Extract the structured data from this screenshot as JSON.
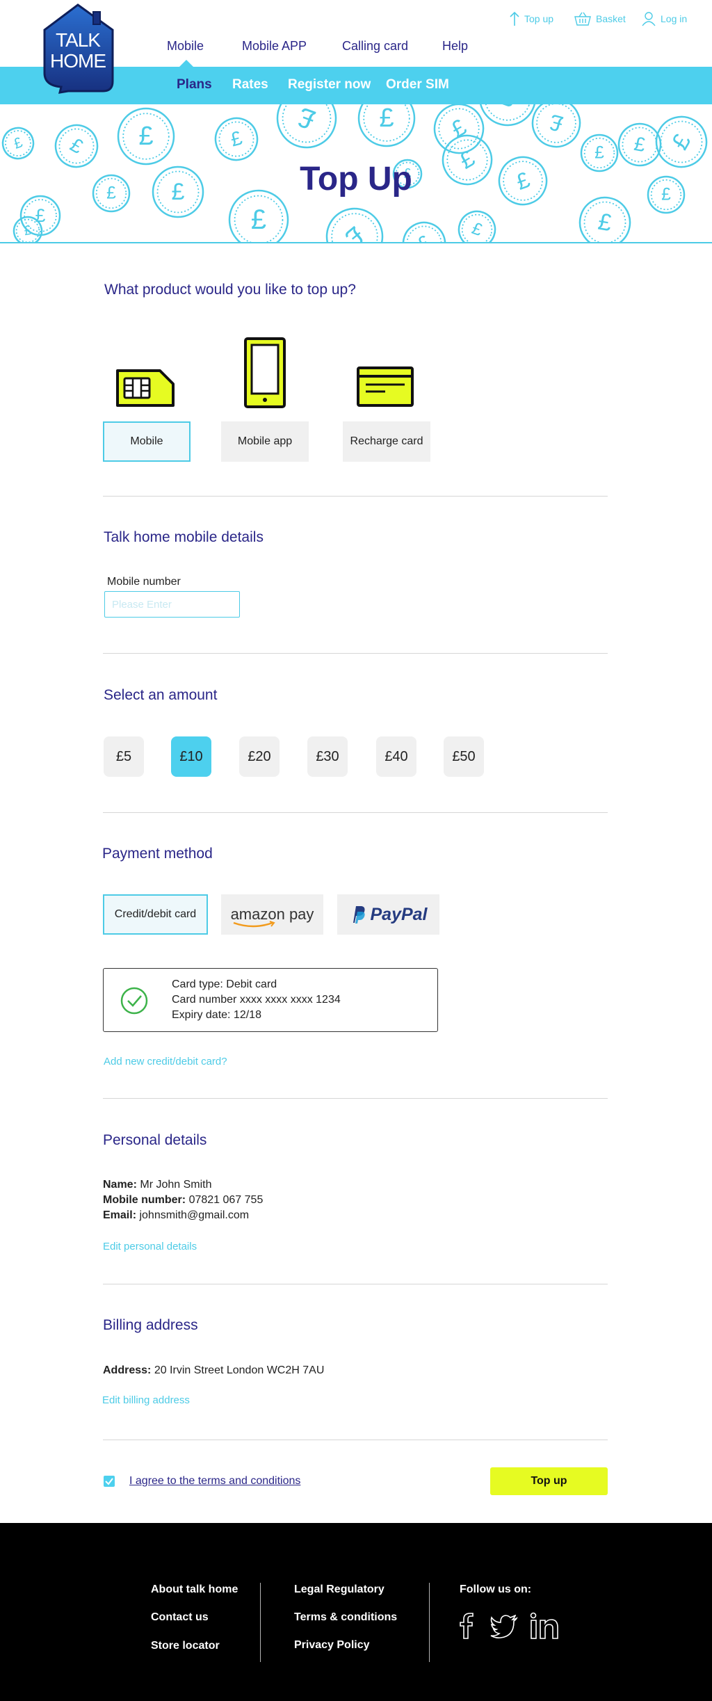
{
  "header": {
    "logo_text_line1": "TALK",
    "logo_text_line2": "HOME",
    "util_links": [
      {
        "label": "Top up",
        "icon": "arrow-up-icon"
      },
      {
        "label": "Basket",
        "icon": "basket-icon"
      },
      {
        "label": "Log in",
        "icon": "user-icon"
      }
    ],
    "main_nav": [
      "Mobile",
      "Mobile APP",
      "Calling card",
      "Help"
    ],
    "sub_nav": [
      "Plans",
      "Rates",
      "Register now",
      "Order SIM"
    ]
  },
  "hero": {
    "title": "Top Up",
    "coin_symbol": "£"
  },
  "product": {
    "title": "What product would you like to top up?",
    "options": [
      "Mobile",
      "Mobile app",
      "Recharge card"
    ],
    "selected": "Mobile"
  },
  "mobile_details": {
    "title": "Talk home mobile details",
    "label": "Mobile number",
    "placeholder": "Please Enter"
  },
  "amount": {
    "title": "Select an amount",
    "options": [
      "£5",
      "£10",
      "£20",
      "£30",
      "£40",
      "£50"
    ],
    "selected": "£10"
  },
  "payment": {
    "title": "Payment method",
    "options": [
      "Credit/debit card",
      "amazon pay",
      "PayPal"
    ],
    "selected": "Credit/debit card",
    "card_type": "Card type: Debit card",
    "card_number": "Card number xxxx xxxx xxxx 1234",
    "expiry": "Expiry date: 12/18",
    "add_card_link": "Add new credit/debit card?"
  },
  "personal": {
    "title": "Personal details",
    "name_label": "Name:",
    "name_value": "Mr John Smith",
    "mobile_label": "Mobile number:",
    "mobile_value": "07821 067 755",
    "email_label": "Email:",
    "email_value": "johnsmith@gmail.com",
    "edit_link": "Edit personal details"
  },
  "billing": {
    "title": "Billing address",
    "address_label": "Address:",
    "address_value": "20 Irvin Street London WC2H 7AU",
    "edit_link": "Edit billing address"
  },
  "submit": {
    "terms_label": "I agree to the terms and conditions",
    "terms_checked": true,
    "button_label": "Top up"
  },
  "footer": {
    "col1": [
      "About talk home",
      "Contact us",
      "Store locator"
    ],
    "col2": [
      "Legal Regulatory",
      "Terms & conditions",
      "Privacy Policy"
    ],
    "follow_label": "Follow us on:",
    "social_icons": [
      "facebook-icon",
      "twitter-icon",
      "linkedin-icon"
    ]
  },
  "colors": {
    "brand_navy": "#2a2688",
    "accent_cyan": "#4dd0ee",
    "accent_yellow": "#e6fb22",
    "footer_bg": "#000000"
  }
}
